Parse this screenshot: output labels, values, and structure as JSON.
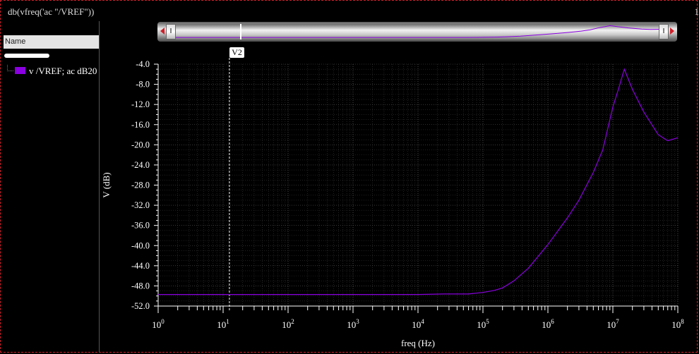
{
  "window": {
    "title": "db(vfreq('ac \"/VREF\"))",
    "corner_text": "1"
  },
  "panel": {
    "column_header": "Name",
    "legend": [
      {
        "label": "v /VREF; ac dB20",
        "color": "#8a00e0"
      }
    ]
  },
  "marker": {
    "label": "V2",
    "x": 12.5
  },
  "chart_data": {
    "type": "line",
    "title": "",
    "xlabel": "freq (Hz)",
    "ylabel": "V (dB)",
    "x_scale": "log",
    "xlim": [
      1,
      100000000
    ],
    "ylim": [
      -52.0,
      -4.0
    ],
    "x_ticks": [
      {
        "value": 1,
        "base": "10",
        "exp": "0"
      },
      {
        "value": 10,
        "base": "10",
        "exp": "1"
      },
      {
        "value": 100,
        "base": "10",
        "exp": "2"
      },
      {
        "value": 1000,
        "base": "10",
        "exp": "3"
      },
      {
        "value": 10000,
        "base": "10",
        "exp": "4"
      },
      {
        "value": 100000,
        "base": "10",
        "exp": "5"
      },
      {
        "value": 1000000,
        "base": "10",
        "exp": "6"
      },
      {
        "value": 10000000,
        "base": "10",
        "exp": "7"
      },
      {
        "value": 100000000,
        "base": "10",
        "exp": "8"
      }
    ],
    "y_ticks": [
      "-4.0",
      "-8.0",
      "-12.0",
      "-16.0",
      "-20.0",
      "-24.0",
      "-28.0",
      "-32.0",
      "-36.0",
      "-40.0",
      "-44.0",
      "-48.0",
      "-52.0"
    ],
    "grid": true,
    "series": [
      {
        "name": "v /VREF; ac dB20",
        "color": "#8a00e0",
        "x": [
          1,
          10,
          100,
          1000,
          10000,
          25000,
          60000,
          100000,
          150000,
          200000,
          300000,
          500000,
          1000000,
          2000000,
          3000000,
          5000000,
          7000000,
          10000000,
          12500000,
          15000000,
          20000000,
          30000000,
          50000000,
          70000000,
          100000000
        ],
        "y": [
          -49.7,
          -49.7,
          -49.7,
          -49.7,
          -49.7,
          -49.6,
          -49.6,
          -49.3,
          -48.9,
          -48.4,
          -47.0,
          -44.5,
          -39.8,
          -34.5,
          -31.0,
          -25.5,
          -21.0,
          -12.5,
          -8.5,
          -5.0,
          -9.0,
          -13.5,
          -18.0,
          -19.2,
          -18.6
        ]
      }
    ]
  }
}
